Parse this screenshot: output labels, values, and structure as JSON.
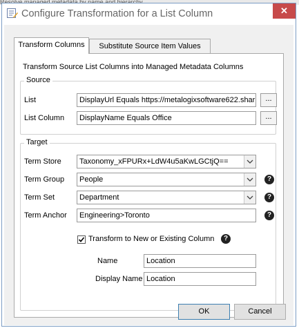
{
  "background_text": "Resolve managed metadata by name and hierarchy",
  "window": {
    "title": "Configure Transformation for a List Column",
    "close_glyph": "✕"
  },
  "tabs": [
    {
      "label": "Transform Columns",
      "active": true
    },
    {
      "label": "Substitute Source Item Values",
      "active": false
    }
  ],
  "description": "Transform Source List Columns into Managed Metadata Columns",
  "source": {
    "legend": "Source",
    "list_label": "List",
    "list_value": "DisplayUrl Equals https://metalogixsoftware622.shar",
    "list_column_label": "List Column",
    "list_column_value": "DisplayName Equals Office",
    "browse_label": "..."
  },
  "target": {
    "legend": "Target",
    "term_store_label": "Term Store",
    "term_store_value": "Taxonomy_xFPURx+LdW4u5aKwLGCtjQ==",
    "term_group_label": "Term Group",
    "term_group_value": "People",
    "term_set_label": "Term Set",
    "term_set_value": "Department",
    "term_anchor_label": "Term Anchor",
    "term_anchor_value": "Engineering>Toronto",
    "transform_checkbox_label": "Transform to New or Existing Column",
    "transform_checked": true,
    "name_label": "Name",
    "name_value": "Location",
    "display_name_label": "Display Name",
    "display_name_value": "Location"
  },
  "help_glyph": "?",
  "buttons": {
    "ok": "OK",
    "cancel": "Cancel"
  },
  "colors": {
    "close_button": "#c74a4a",
    "window_border": "#7a9cc4",
    "dialog_background": "#f0f0f0"
  }
}
